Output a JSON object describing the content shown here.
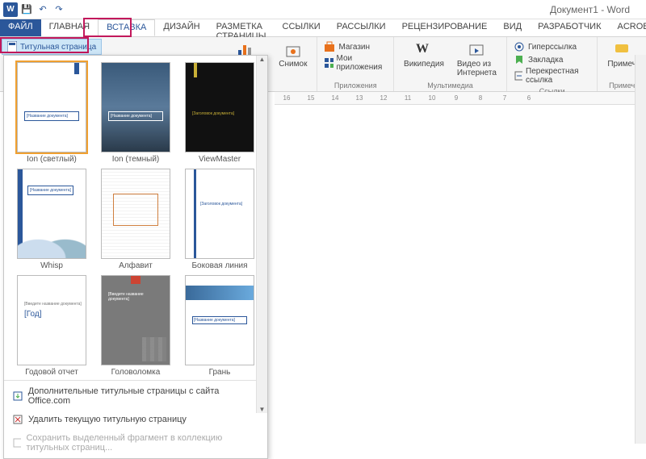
{
  "titlebar": {
    "title": "Документ1 - Word"
  },
  "tabs": {
    "file": "ФАЙЛ",
    "items": [
      "ГЛАВНАЯ",
      "ВСТАВКА",
      "ДИЗАЙН",
      "РАЗМЕТКА СТРАНИЦЫ",
      "ССЫЛКИ",
      "РАССЫЛКИ",
      "РЕЦЕНЗИРОВАНИЕ",
      "ВИД",
      "РАЗРАБОТЧИК",
      "ACROBAT"
    ],
    "active_index": 1
  },
  "ribbon": {
    "cover_page_btn": "Титульная страница",
    "illustrations": {
      "chart": "Диаграмма",
      "screenshot": "Снимок",
      "group": ""
    },
    "apps": {
      "store": "Магазин",
      "myapps": "Мои приложения",
      "group": "Приложения"
    },
    "media": {
      "wikipedia": "Википедия",
      "online_video": "Видео из Интернета",
      "group": "Мультимедиа"
    },
    "links": {
      "hyperlink": "Гиперссылка",
      "bookmark": "Закладка",
      "crossref": "Перекрестная ссылка",
      "group": "Ссылки"
    },
    "comments": {
      "comment": "Примеч",
      "group": "Примеч"
    }
  },
  "gallery": {
    "items": [
      {
        "label": "Ion (светлый)",
        "preview_text": "[Название документа]"
      },
      {
        "label": "Ion (темный)",
        "preview_text": "[Название документа]"
      },
      {
        "label": "ViewMaster",
        "preview_text": "[Заголовок документа]"
      },
      {
        "label": "Whisp",
        "preview_text": "[Название документа]"
      },
      {
        "label": "Алфавит",
        "preview_text": ""
      },
      {
        "label": "Боковая линия",
        "preview_text": "[Заголовок документа]"
      },
      {
        "label": "Годовой отчет",
        "preview_year": "[Год]",
        "preview_text": "[Введите название документа]"
      },
      {
        "label": "Головоломка",
        "preview_text": "[Введите название документа]"
      },
      {
        "label": "Грань",
        "preview_text": "[Название документа]"
      }
    ],
    "selected_index": 0,
    "footer": {
      "more": "Дополнительные титульные страницы с сайта Office.com",
      "remove": "Удалить текущую титульную страницу",
      "save": "Сохранить выделенный фрагмент в коллекцию титульных страниц..."
    }
  },
  "ruler": {
    "marks": [
      "16",
      "15",
      "14",
      "13",
      "12",
      "11",
      "10",
      "9",
      "8",
      "7",
      "6"
    ]
  }
}
